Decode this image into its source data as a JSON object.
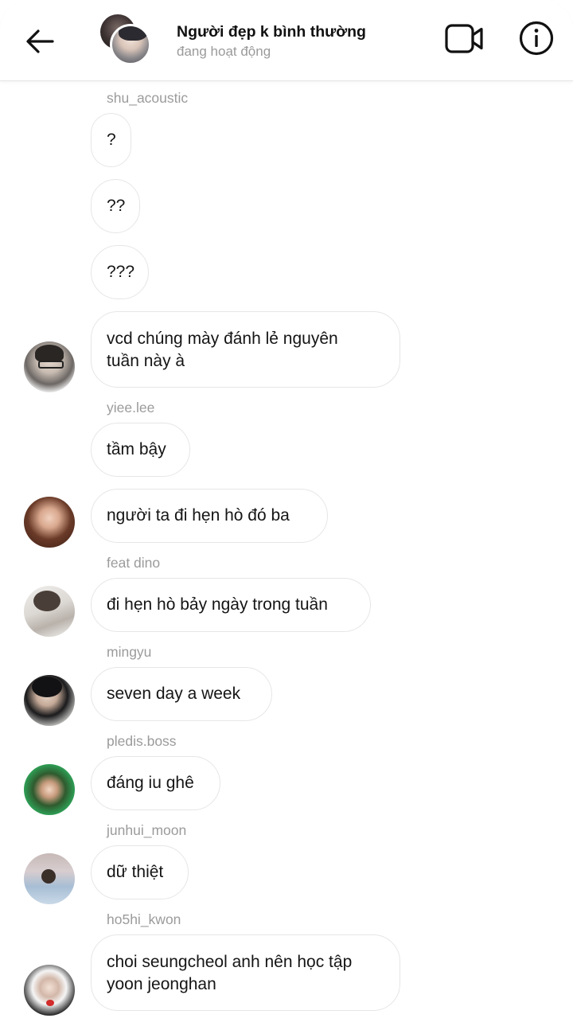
{
  "header": {
    "title": "Người đẹp k bình thường",
    "status": "đang hoạt động",
    "back_icon": "arrow-left-icon",
    "video_icon": "video-camera-icon",
    "info_icon": "info-circle-icon"
  },
  "messages": [
    {
      "sender": "shu_acoustic"
    },
    {
      "text": "?"
    },
    {
      "text": "??"
    },
    {
      "text": "???"
    },
    {
      "text": "vcd chúng mày đánh lẻ nguyên tuần này à"
    },
    {
      "sender": "yiee.lee"
    },
    {
      "text": "tầm bậy"
    },
    {
      "text": "người ta đi hẹn hò đó ba"
    },
    {
      "sender": "feat dino"
    },
    {
      "text": "đi hẹn hò bảy ngày trong tuần"
    },
    {
      "sender": "mingyu"
    },
    {
      "text": "seven day a week"
    },
    {
      "sender": "pledis.boss"
    },
    {
      "text": "đáng iu ghê"
    },
    {
      "sender": "junhui_moon"
    },
    {
      "text": "dữ thiệt"
    },
    {
      "sender": "ho5hi_kwon"
    },
    {
      "text": "choi seungcheol anh nên học tập yoon jeonghan"
    }
  ],
  "colors": {
    "background": "#ffffff",
    "bubble_border": "#e6e6e6",
    "sender_text": "#9b9b9b",
    "status_text": "#9a9a9a"
  }
}
